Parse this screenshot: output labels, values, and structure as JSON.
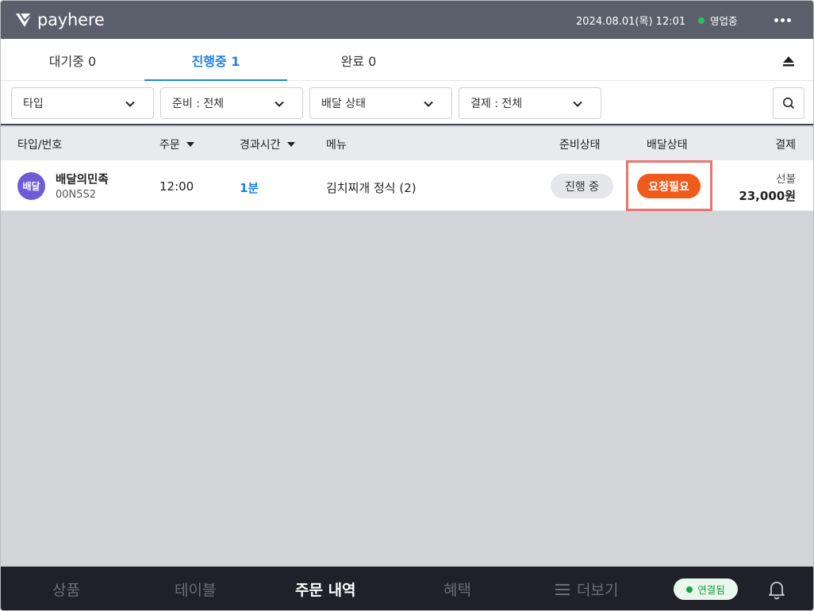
{
  "topbar": {
    "brand": "payhere",
    "datetime": "2024.08.01(목) 12:01",
    "store_status": "영업중"
  },
  "tabs": [
    {
      "label": "대기중 0",
      "active": false
    },
    {
      "label": "진행중 1",
      "active": true
    },
    {
      "label": "완료 0",
      "active": false
    }
  ],
  "filters": {
    "type": "타입",
    "prep": "준비 : 전체",
    "delivery": "배달 상태",
    "payment": "결제 : 전체"
  },
  "table": {
    "headers": {
      "type_no": "타입/번호",
      "order": "주문",
      "elapsed": "경과시간",
      "menu": "메뉴",
      "prep_status": "준비상태",
      "delivery_status": "배달상태",
      "payment": "결제"
    },
    "rows": [
      {
        "avatar": "배달",
        "platform": "배달의민족",
        "order_no": "00N5S2",
        "order_time": "12:00",
        "elapsed": "1분",
        "menu": "김치찌개 정식 (2)",
        "prep_status": "진행 중",
        "delivery_status": "요청필요",
        "pay_type": "선불",
        "pay_amount": "23,000원"
      }
    ]
  },
  "bottomnav": {
    "products": "상품",
    "tables": "테이블",
    "orders": "주문 내역",
    "benefits": "혜택",
    "more": "더보기",
    "connection": "연결됨"
  },
  "colors": {
    "accent": "#1f82e6",
    "delivery_badge": "#f05a1a",
    "avatar": "#6e5bd8",
    "highlight_border": "#e9756e"
  },
  "icons": {
    "logo": "payhere-logo-icon",
    "more": "more-dots-icon",
    "eject": "eject-icon",
    "search": "search-icon",
    "chevron": "chevron-down-icon",
    "bell": "bell-icon",
    "menu": "hamburger-icon"
  }
}
